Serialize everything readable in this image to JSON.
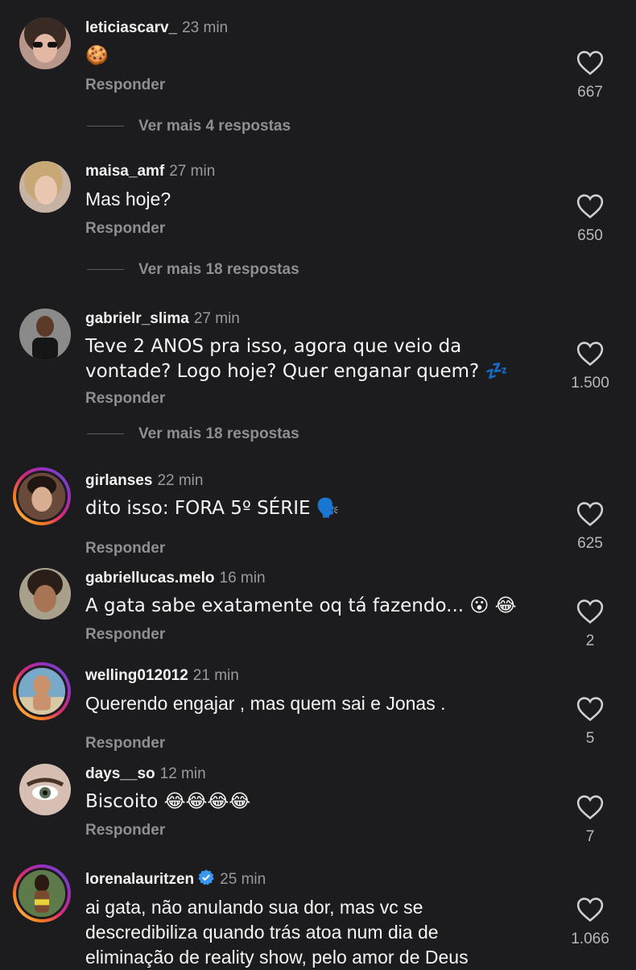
{
  "reply_label": "Responder",
  "comments": [
    {
      "username": "leticiascarv_",
      "time": "23 min",
      "text": "🍪",
      "likes": "667",
      "more": "Ver mais 4 respostas"
    },
    {
      "username": "maisa_amf",
      "time": "27 min",
      "text": "Mas hoje?",
      "likes": "650",
      "more": "Ver mais 18 respostas"
    },
    {
      "username": "gabrielr_slima",
      "time": "27 min",
      "text_line1": "Teve 2 ANOS pra isso, agora que veio da",
      "text_line2": "vontade? Logo hoje? Quer enganar quem? 💤",
      "likes": "1.500",
      "more": "Ver mais 18 respostas"
    },
    {
      "username": "girlanses",
      "time": "22 min",
      "text": "dito isso: FORA 5º SÉRIE 🗣️",
      "likes": "625"
    },
    {
      "username": "gabriellucas.melo",
      "time": "16 min",
      "text": "A gata sabe exatamente oq tá fazendo... 😮 😂",
      "likes": "2"
    },
    {
      "username": "welling012012",
      "time": "21 min",
      "text": "Querendo engajar , mas quem sai e Jonas .",
      "likes": "5"
    },
    {
      "username": "days__so",
      "time": "12 min",
      "text": "Biscoito 😂😂😂😂",
      "likes": "7"
    },
    {
      "username": "lorenalauritzen",
      "time": "25 min",
      "text_line1": "ai gata, não anulando sua dor, mas vc se",
      "text_line2": "descredibiliza quando trás atoa num dia de",
      "text_line3": "eliminação de reality show, pelo amor de Deus",
      "likes": "1.066"
    }
  ],
  "colors": {
    "background": "#1c1c1e",
    "accent_verified": "#3897f0"
  }
}
